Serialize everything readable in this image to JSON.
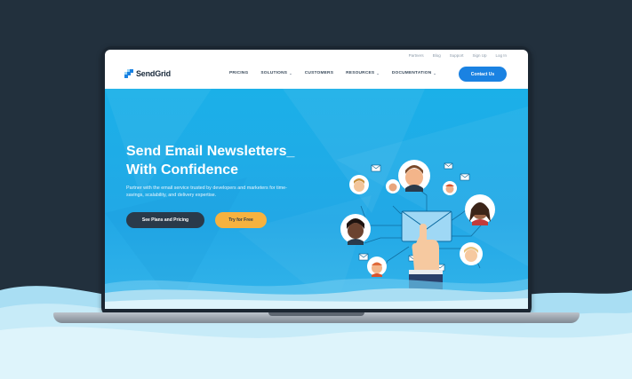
{
  "colors": {
    "background": "#22303d",
    "brand_blue": "#1a82e2",
    "hero_blue": "#1bb0e8",
    "dark_button": "#2a3a4a",
    "accent_yellow": "#f6b23f"
  },
  "utility_nav": [
    "Partners",
    "Blog",
    "Support",
    "Sign Up",
    "Log In"
  ],
  "brand": {
    "name": "SendGrid",
    "logo_icon": "sendgrid-logo-icon"
  },
  "main_nav": [
    {
      "label": "PRICING",
      "has_dropdown": false
    },
    {
      "label": "SOLUTIONS",
      "has_dropdown": true
    },
    {
      "label": "CUSTOMERS",
      "has_dropdown": false
    },
    {
      "label": "RESOURCES",
      "has_dropdown": true
    },
    {
      "label": "DOCUMENTATION",
      "has_dropdown": true
    }
  ],
  "contact_button": "Contact Us",
  "hero": {
    "title_line1": "Send Email Newsletters",
    "title_cursor": "_",
    "title_line2": "With Confidence",
    "description": "Partner with the email service trusted by developers and marketers for time-savings, scalability, and delivery expertise.",
    "primary_button": "See Plans and Pricing",
    "secondary_button": "Try for Free"
  },
  "illustration": {
    "icons": [
      "envelope-icon",
      "hand-icon",
      "avatar-icon",
      "mail-icon"
    ]
  }
}
